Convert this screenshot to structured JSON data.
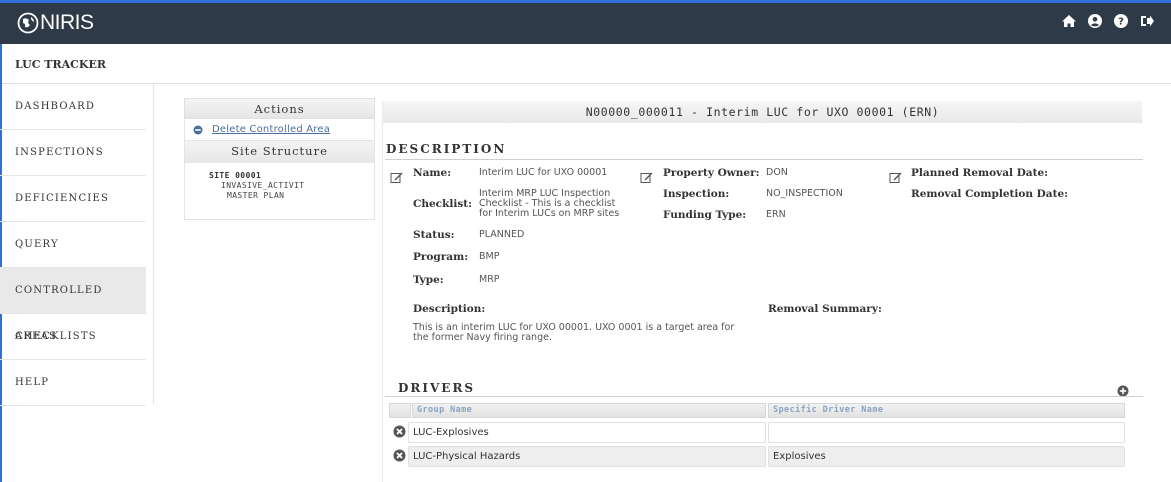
{
  "app": {
    "name": "NIRIS"
  },
  "header": {
    "title": "LUC TRACKER"
  },
  "sidebar": {
    "items": [
      {
        "label": "DASHBOARD"
      },
      {
        "label": "INSPECTIONS"
      },
      {
        "label": "DEFICIENCIES"
      },
      {
        "label": "QUERY"
      },
      {
        "label": "CONTROLLED AREAS",
        "active": true
      },
      {
        "label": "CHECKLISTS"
      },
      {
        "label": "HELP"
      }
    ]
  },
  "actions": {
    "title": "Actions",
    "delete_link": "Delete Controlled Area",
    "site_structure_title": "Site Structure",
    "site_name": "SITE 00001",
    "site_child_1": "INVASIVE_ACTIVIT",
    "site_child_2": "MASTER PLAN"
  },
  "record": {
    "title": "N00000_000011 - Interim LUC for UXO 00001 (ERN)",
    "description_section": "DESCRIPTION",
    "name_label": "Name:",
    "name_value": "Interim LUC for UXO 00001",
    "checklist_label": "Checklist:",
    "checklist_value_1": "Interim MRP LUC Inspection",
    "checklist_value_2": "Checklist - This is a checklist",
    "checklist_value_3": "for Interim LUCs on MRP sites",
    "status_label": "Status:",
    "status_value": "PLANNED",
    "program_label": "Program:",
    "program_value": "BMP",
    "type_label": "Type:",
    "type_value": "MRP",
    "owner_label": "Property Owner:",
    "owner_value": "DON",
    "inspection_label": "Inspection:",
    "inspection_value": "NO_INSPECTION",
    "funding_label": "Funding Type:",
    "funding_value": "ERN",
    "planned_removal_label": "Planned Removal Date:",
    "removal_completion_label": "Removal Completion Date:",
    "description_label": "Description:",
    "description_text_1": "This is an interim LUC for UXO 00001. UXO 0001 is a target area for",
    "description_text_2": "the former Navy firing range.",
    "removal_summary_label": "Removal Summary:"
  },
  "drivers": {
    "section": "DRIVERS",
    "columns": [
      "Group Name",
      "Specific Driver Name"
    ],
    "rows": [
      {
        "group": "LUC-Explosives",
        "driver": ""
      },
      {
        "group": "LUC-Physical Hazards",
        "driver": "Explosives"
      }
    ]
  },
  "icons": {
    "top": [
      "home-icon",
      "user-icon",
      "help-icon",
      "logout-icon"
    ]
  }
}
